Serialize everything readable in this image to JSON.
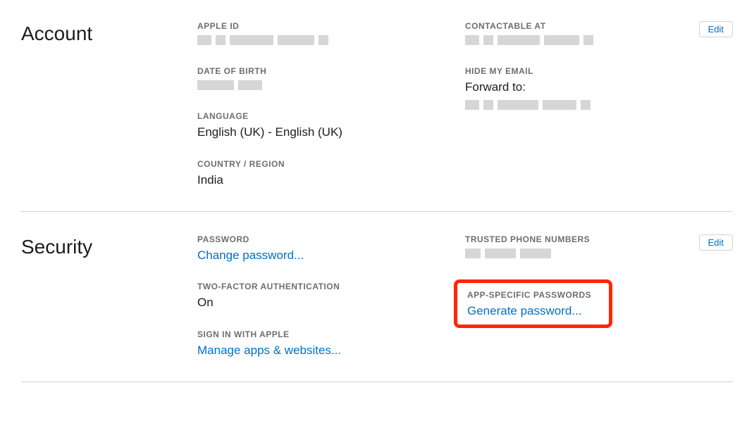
{
  "account": {
    "title": "Account",
    "edit_label": "Edit",
    "apple_id": {
      "label": "APPLE ID"
    },
    "date_of_birth": {
      "label": "DATE OF BIRTH"
    },
    "language": {
      "label": "LANGUAGE",
      "value": "English (UK) - English (UK)"
    },
    "country_region": {
      "label": "COUNTRY / REGION",
      "value": "India"
    },
    "contactable_at": {
      "label": "CONTACTABLE AT"
    },
    "hide_my_email": {
      "label": "HIDE MY EMAIL",
      "value": "Forward to:"
    }
  },
  "security": {
    "title": "Security",
    "edit_label": "Edit",
    "password": {
      "label": "PASSWORD",
      "link": "Change password..."
    },
    "two_factor": {
      "label": "TWO-FACTOR AUTHENTICATION",
      "value": "On"
    },
    "sign_in_with_apple": {
      "label": "SIGN IN WITH APPLE",
      "link": "Manage apps & websites..."
    },
    "trusted_phone": {
      "label": "TRUSTED PHONE NUMBERS"
    },
    "app_specific_passwords": {
      "label": "APP-SPECIFIC PASSWORDS",
      "link": "Generate password..."
    }
  }
}
